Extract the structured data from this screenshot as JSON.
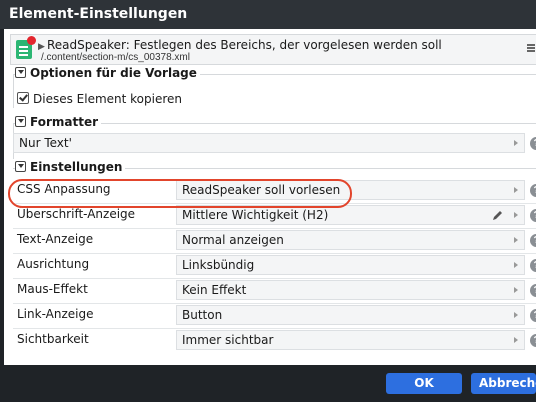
{
  "window": {
    "title": "Element-Einstellungen"
  },
  "header": {
    "title": "ReadSpeaker: Festlegen des Bereichs, der vorgelesen werden soll",
    "path": "/.content/section-m/cs_00378.xml",
    "doc_icon": "document-icon",
    "menu_icon": "hamburger-menu-icon"
  },
  "sections": {
    "template_options": {
      "legend": "Optionen für die Vorlage",
      "copy_checkbox": {
        "label": "Dieses Element kopieren",
        "checked": true
      }
    },
    "formatter": {
      "legend": "Formatter",
      "value": "Nur Text'"
    },
    "settings": {
      "legend": "Einstellungen",
      "rows": [
        {
          "label": "CSS Anpassung",
          "value": "ReadSpeaker soll vorlesen"
        },
        {
          "label": "Überschrift-Anzeige",
          "value": "Mittlere Wichtigkeit (H2)"
        },
        {
          "label": "Text-Anzeige",
          "value": "Normal anzeigen"
        },
        {
          "label": "Ausrichtung",
          "value": "Linksbündig"
        },
        {
          "label": "Maus-Effekt",
          "value": "Kein Effekt"
        },
        {
          "label": "Link-Anzeige",
          "value": "Button"
        },
        {
          "label": "Sichtbarkeit",
          "value": "Immer sichtbar"
        }
      ]
    }
  },
  "buttons": {
    "ok": "OK",
    "cancel": "Abbrechen"
  },
  "colors": {
    "accent": "#2d6fe0",
    "highlight": "#e2452c",
    "titlebar": "#2e3338"
  }
}
